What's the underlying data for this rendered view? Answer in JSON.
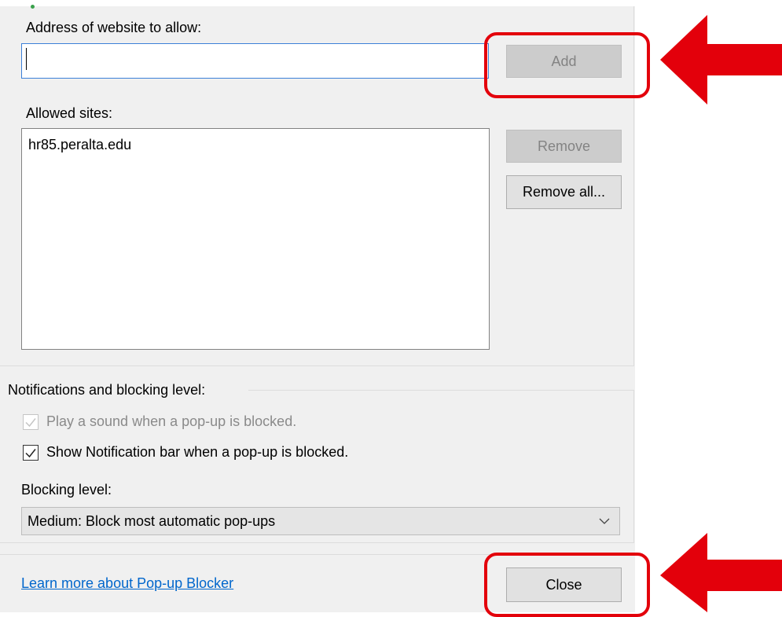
{
  "exceptions": {
    "address_label": "Address of website to allow:",
    "address_value": "",
    "add_button": "Add",
    "allowed_label": "Allowed sites:",
    "allowed_sites": [
      "hr85.peralta.edu"
    ],
    "remove_button": "Remove",
    "remove_all_button": "Remove all..."
  },
  "notifications": {
    "group_label": "Notifications and blocking level:",
    "play_sound_label": "Play a sound when a pop-up is blocked.",
    "play_sound_checked": true,
    "show_bar_label": "Show Notification bar when a pop-up is blocked.",
    "show_bar_checked": true,
    "blocking_level_label": "Blocking level:",
    "blocking_level_value": "Medium: Block most automatic pop-ups"
  },
  "footer": {
    "learn_more_link": "Learn more about Pop-up Blocker",
    "close_button": "Close"
  },
  "colors": {
    "annotation_red": "#e3000b",
    "link_blue": "#0066cc",
    "input_focus_border": "#3c80d8"
  },
  "icons": {
    "check": "check-icon",
    "dropdown": "chevron-down-icon",
    "annotation": "red-arrow-icon"
  }
}
